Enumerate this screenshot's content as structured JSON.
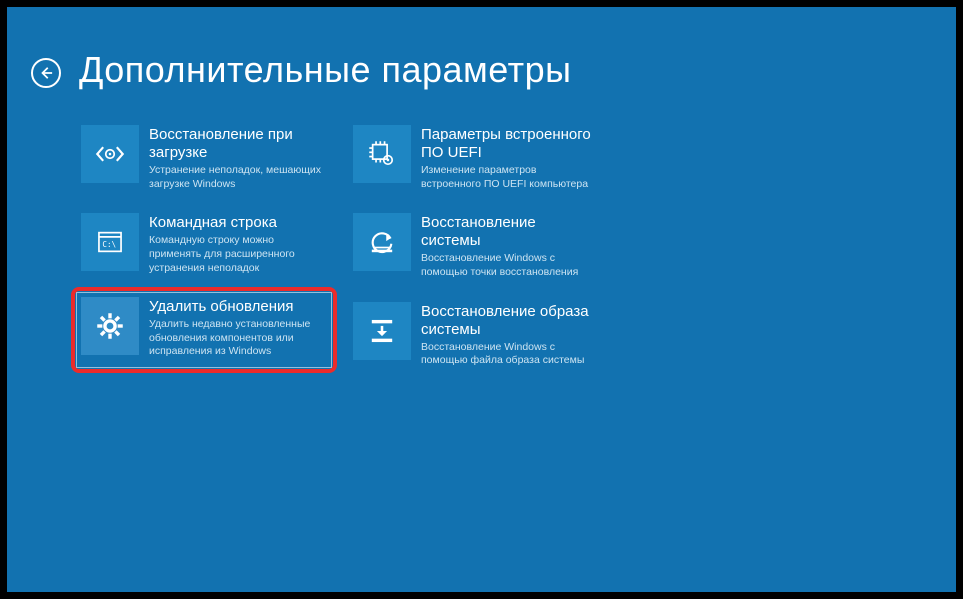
{
  "header": {
    "title": "Дополнительные параметры"
  },
  "colors": {
    "background": "#1272b0",
    "tileIcon": "#1e86c3",
    "highlight": "#ec2b2a"
  },
  "options": {
    "left": [
      {
        "icon": "code-repair-icon",
        "title": "Восстановление при загрузке",
        "desc": "Устранение неполадок, мешающих загрузке Windows"
      },
      {
        "icon": "cmd-icon",
        "title": "Командная строка",
        "desc": "Командную строку можно применять для расширенного устранения неполадок"
      },
      {
        "icon": "gear-icon",
        "title": "Удалить обновления",
        "desc": "Удалить недавно установленные обновления компонентов или исправления из Windows",
        "highlighted": true
      }
    ],
    "right": [
      {
        "icon": "chip-gear-icon",
        "title": "Параметры встроенного ПО UEFI",
        "desc": "Изменение параметров встроенного ПО UEFI компьютера"
      },
      {
        "icon": "restore-icon",
        "title": "Восстановление системы",
        "desc": "Восстановление Windows с помощью точки восстановления"
      },
      {
        "icon": "image-restore-icon",
        "title": "Восстановление образа системы",
        "desc": "Восстановление Windows с помощью файла образа системы"
      }
    ]
  }
}
